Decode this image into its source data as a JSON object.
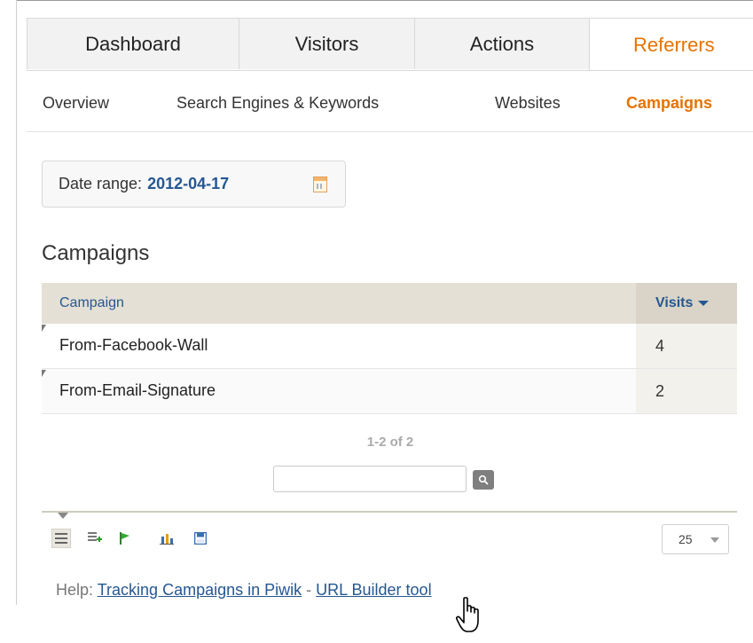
{
  "tabs": [
    {
      "label": "Dashboard",
      "active": false
    },
    {
      "label": "Visitors",
      "active": false
    },
    {
      "label": "Actions",
      "active": false
    },
    {
      "label": "Referrers",
      "active": true
    }
  ],
  "subnav": [
    {
      "label": "Overview",
      "active": false
    },
    {
      "label": "Search Engines & Keywords",
      "active": false
    },
    {
      "label": "Websites",
      "active": false
    },
    {
      "label": "Campaigns",
      "active": true
    }
  ],
  "date_range": {
    "label": "Date range:",
    "value": "2012-04-17",
    "icon": "calendar-icon"
  },
  "section_title": "Campaigns",
  "table": {
    "headers": {
      "label": "Campaign",
      "metric": "Visits"
    },
    "sort": "descending",
    "rows": [
      {
        "label": "From-Facebook-Wall",
        "visits": "4"
      },
      {
        "label": "From-Email-Signature",
        "visits": "2"
      }
    ]
  },
  "pagination": "1-2 of 2",
  "search": {
    "value": "",
    "icon": "search-icon"
  },
  "footer": {
    "view_icons": [
      "table-view-icon",
      "table-more-columns-icon",
      "goals-flag-icon",
      "bar-chart-icon",
      "export-save-icon"
    ],
    "limit": "25"
  },
  "help": {
    "prefix": "Help:",
    "link1": "Tracking Campaigns in Piwik",
    "separator": "-",
    "link2": "URL Builder tool"
  },
  "colors": {
    "accent": "#e57300",
    "link": "#255792",
    "header_bg": "#e4e0d5"
  }
}
